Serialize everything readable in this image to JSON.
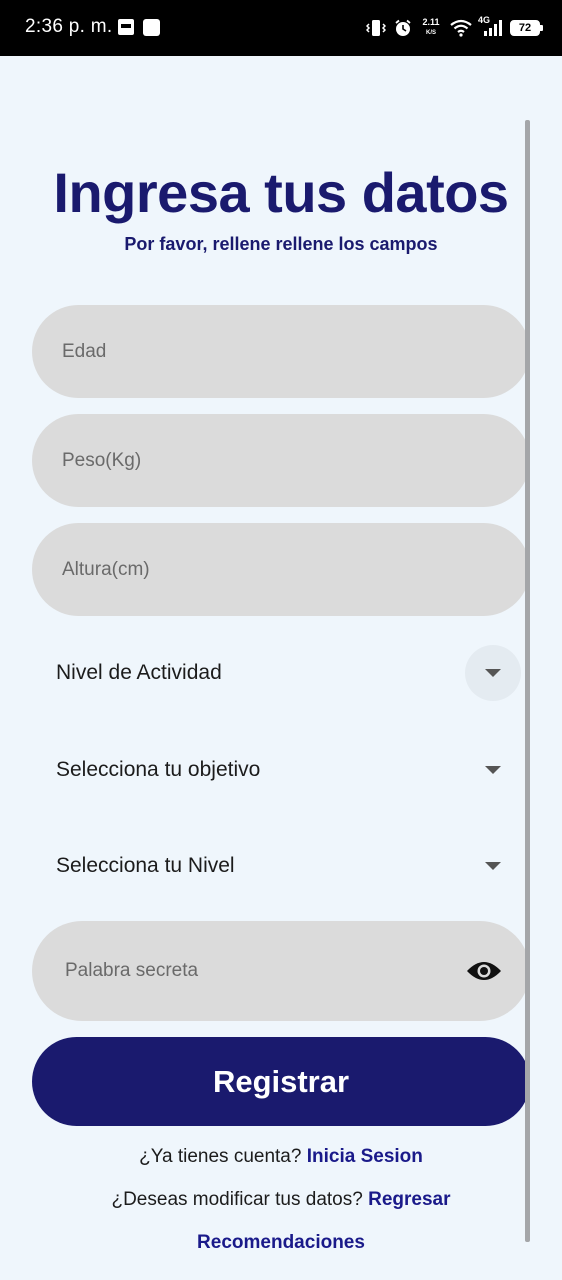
{
  "status_bar": {
    "time": "2:36 p. m.",
    "net_speed_value": "2.11",
    "net_speed_unit": "K/S",
    "network_type": "4G",
    "battery": "72"
  },
  "header": {
    "title": "Ingresa tus datos",
    "subtitle": "Por favor, rellene rellene los campos"
  },
  "form": {
    "age": {
      "placeholder": "Edad",
      "value": ""
    },
    "weight": {
      "placeholder": "Peso(Kg)",
      "value": ""
    },
    "height": {
      "placeholder": "Altura(cm)",
      "value": ""
    },
    "activity_dropdown": {
      "label": "Nivel de Actividad"
    },
    "goal_dropdown": {
      "label": "Selecciona tu objetivo"
    },
    "level_dropdown": {
      "label": "Selecciona tu Nivel"
    },
    "secret": {
      "placeholder": "Palabra secreta",
      "value": ""
    },
    "register_label": "Registrar"
  },
  "footer": {
    "login_prompt": "¿Ya tienes cuenta?",
    "login_link": "Inicia Sesion",
    "modify_prompt": "¿Deseas modificar tus datos?",
    "modify_link": "Regresar",
    "recommendations_link": "Recomendaciones"
  },
  "colors": {
    "primary": "#1a1a6e",
    "background": "#eff6fc",
    "field": "#dbdbdb"
  }
}
